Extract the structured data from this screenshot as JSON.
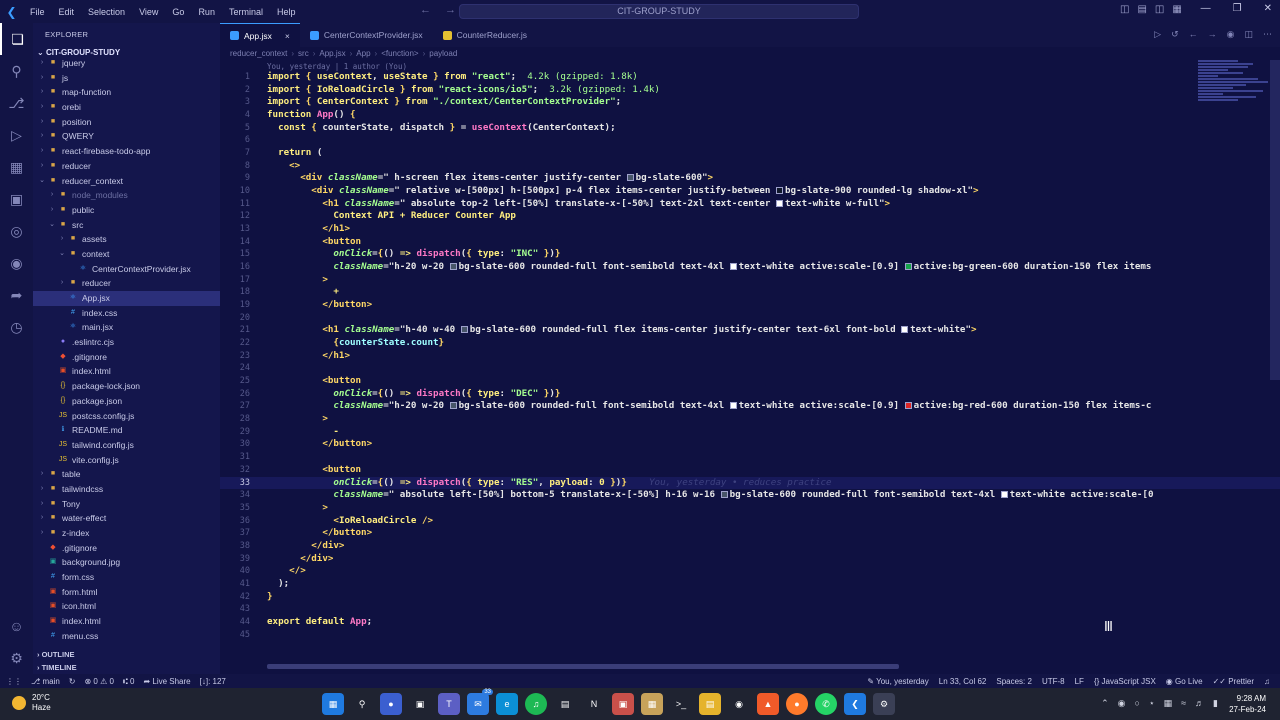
{
  "titlebar": {
    "menu": [
      "File",
      "Edit",
      "Selection",
      "View",
      "Go",
      "Run",
      "Terminal",
      "Help"
    ],
    "search": "CIT-GROUP-STUDY"
  },
  "sidebar": {
    "header": "EXPLORER",
    "project": "CIT-GROUP-STUDY",
    "items": [
      {
        "label": "jquery",
        "depth": 1,
        "type": "folder",
        "open": false
      },
      {
        "label": "js",
        "depth": 1,
        "type": "folder",
        "open": false
      },
      {
        "label": "map-function",
        "depth": 1,
        "type": "folder",
        "open": false
      },
      {
        "label": "orebi",
        "depth": 1,
        "type": "folder",
        "open": false
      },
      {
        "label": "position",
        "depth": 1,
        "type": "folder",
        "open": false
      },
      {
        "label": "QWERY",
        "depth": 1,
        "type": "folder",
        "open": false
      },
      {
        "label": "react-firebase-todo-app",
        "depth": 1,
        "type": "folder",
        "open": false
      },
      {
        "label": "reducer",
        "depth": 1,
        "type": "folder",
        "open": false
      },
      {
        "label": "reducer_context",
        "depth": 1,
        "type": "folder",
        "open": true
      },
      {
        "label": "node_modules",
        "depth": 2,
        "type": "folder",
        "open": false,
        "dim": true
      },
      {
        "label": "public",
        "depth": 2,
        "type": "folder",
        "open": false
      },
      {
        "label": "src",
        "depth": 2,
        "type": "folder",
        "open": true
      },
      {
        "label": "assets",
        "depth": 3,
        "type": "folder",
        "open": false
      },
      {
        "label": "context",
        "depth": 3,
        "type": "folder",
        "open": true
      },
      {
        "label": "CenterContextProvider.jsx",
        "depth": 4,
        "type": "jsx"
      },
      {
        "label": "reducer",
        "depth": 3,
        "type": "folder",
        "open": false
      },
      {
        "label": "App.jsx",
        "depth": 3,
        "type": "jsx",
        "selected": true
      },
      {
        "label": "index.css",
        "depth": 3,
        "type": "css"
      },
      {
        "label": "main.jsx",
        "depth": 3,
        "type": "jsx"
      },
      {
        "label": ".eslintrc.cjs",
        "depth": 2,
        "type": "cfg"
      },
      {
        "label": ".gitignore",
        "depth": 2,
        "type": "git"
      },
      {
        "label": "index.html",
        "depth": 2,
        "type": "html"
      },
      {
        "label": "package-lock.json",
        "depth": 2,
        "type": "json"
      },
      {
        "label": "package.json",
        "depth": 2,
        "type": "json"
      },
      {
        "label": "postcss.config.js",
        "depth": 2,
        "type": "js"
      },
      {
        "label": "README.md",
        "depth": 2,
        "type": "md"
      },
      {
        "label": "tailwind.config.js",
        "depth": 2,
        "type": "js"
      },
      {
        "label": "vite.config.js",
        "depth": 2,
        "type": "js"
      },
      {
        "label": "table",
        "depth": 1,
        "type": "folder",
        "open": false
      },
      {
        "label": "tailwindcss",
        "depth": 1,
        "type": "folder",
        "open": false
      },
      {
        "label": "Tony",
        "depth": 1,
        "type": "folder",
        "open": false
      },
      {
        "label": "water-effect",
        "depth": 1,
        "type": "folder",
        "open": false
      },
      {
        "label": "z-index",
        "depth": 1,
        "type": "folder",
        "open": false
      },
      {
        "label": ".gitignore",
        "depth": 1,
        "type": "git"
      },
      {
        "label": "background.jpg",
        "depth": 1,
        "type": "img"
      },
      {
        "label": "form.css",
        "depth": 1,
        "type": "css"
      },
      {
        "label": "form.html",
        "depth": 1,
        "type": "html"
      },
      {
        "label": "icon.html",
        "depth": 1,
        "type": "html"
      },
      {
        "label": "index.html",
        "depth": 1,
        "type": "html"
      },
      {
        "label": "menu.css",
        "depth": 1,
        "type": "css"
      }
    ],
    "outline": "OUTLINE",
    "timeline": "TIMELINE"
  },
  "tabs": [
    {
      "label": "App.jsx",
      "active": true,
      "close": "×"
    },
    {
      "label": "CenterContextProvider.jsx",
      "active": false
    },
    {
      "label": "CounterReducer.js",
      "active": false
    }
  ],
  "breadcrumb": [
    "reducer_context",
    "src",
    "App.jsx",
    "App",
    "<function>",
    "payload"
  ],
  "editor": {
    "blame_top": "You, yesterday | 1 author (You)",
    "blame_current": "You, yesterday • reduces practice"
  },
  "statusbar": {
    "branch": "main",
    "problems": "⊗ 0 ⚠ 0",
    "ports": "⑆ 0",
    "liveshare": "Live Share",
    "selection": "[↓]: 127",
    "blame": "You, yesterday",
    "position": "Ln 33, Col 62",
    "spaces": "Spaces: 2",
    "encoding": "UTF-8",
    "eol": "LF",
    "language": "JavaScript JSX",
    "golive": "Go Live",
    "prettier": "Prettier"
  },
  "taskbar": {
    "temp": "20°C",
    "weather": "Haze",
    "time": "9:28 AM",
    "date": "27-Feb-24",
    "badge": "33"
  }
}
